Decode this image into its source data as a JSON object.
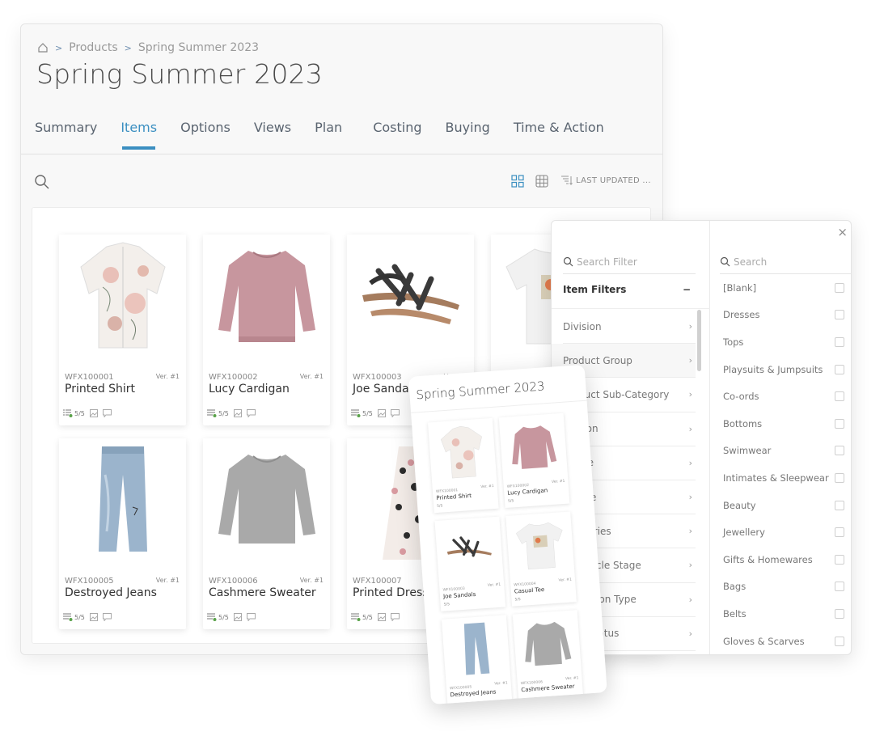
{
  "breadcrumb": {
    "home_icon": "home-icon",
    "items": [
      "Products",
      "Spring Summer 2023"
    ],
    "separator": ">"
  },
  "page": {
    "title": "Spring Summer 2023"
  },
  "tabs": [
    {
      "label": "Summary",
      "active": false
    },
    {
      "label": "Items",
      "active": true
    },
    {
      "label": "Options",
      "active": false
    },
    {
      "label": "Views",
      "active": false
    },
    {
      "label": "Plan",
      "active": false
    },
    {
      "label": "Costing",
      "active": false
    },
    {
      "label": "Buying",
      "active": false
    },
    {
      "label": "Time & Action",
      "active": false
    }
  ],
  "toolbar": {
    "search_icon": "search-icon",
    "grid_view_icon": "grid-view-icon",
    "table_view_icon": "table-view-icon",
    "sort_label": "LAST UPDATED ..."
  },
  "accent_color": "#3b8fc1",
  "items": [
    {
      "code": "WFX100001",
      "name": "Printed Shirt",
      "version": "Ver. #1",
      "progress": "5/5"
    },
    {
      "code": "WFX100002",
      "name": "Lucy Cardigan",
      "version": "Ver. #1",
      "progress": "5/5"
    },
    {
      "code": "WFX100003",
      "name": "Joe Sandals",
      "version": "Ver. #1",
      "progress": "5/5"
    },
    {
      "code": "WFX100004",
      "name": "Casual Tee",
      "version": "Ver. #1",
      "progress": "5/5"
    },
    {
      "code": "WFX100005",
      "name": "Destroyed Jeans",
      "version": "Ver. #1",
      "progress": "5/5"
    },
    {
      "code": "WFX100006",
      "name": "Cashmere Sweater",
      "version": "Ver. #1",
      "progress": "5/5"
    },
    {
      "code": "WFX100007",
      "name": "Printed Dress",
      "version": "Ver. #1",
      "progress": "5/5"
    }
  ],
  "filters": {
    "search_placeholder": "Search Filter",
    "group_title": "Item Filters",
    "group_toggle": "−",
    "categories": [
      "Division",
      "Product Group",
      "Product Sub-Category",
      "Season",
      "Range",
      "Theme",
      "Deliveries",
      "Life Cycle Stage",
      "Collection Type",
      "Item Status"
    ],
    "values_search_placeholder": "Search",
    "values": [
      "[Blank]",
      "Dresses",
      "Tops",
      "Playsuits & Jumpsuits",
      "Co-ords",
      "Bottoms",
      "Swimwear",
      "Intimates & Sleepwear",
      "Beauty",
      "Jewellery",
      "Gifts & Homewares",
      "Bags",
      "Belts",
      "Gloves & Scarves"
    ],
    "close_label": "×"
  },
  "mobile": {
    "title": "Spring Summer 2023"
  }
}
